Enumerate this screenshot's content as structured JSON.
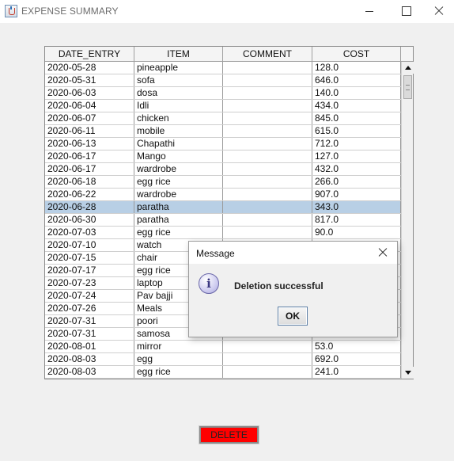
{
  "window": {
    "title": "EXPENSE SUMMARY"
  },
  "table": {
    "columns": [
      "DATE_ENTRY",
      "ITEM",
      "COMMENT",
      "COST"
    ],
    "rows": [
      [
        "2020-05-28",
        "pineapple",
        "",
        "128.0"
      ],
      [
        "2020-05-31",
        "sofa",
        "",
        "646.0"
      ],
      [
        "2020-06-03",
        "dosa",
        "",
        "140.0"
      ],
      [
        "2020-06-04",
        "Idli",
        "",
        "434.0"
      ],
      [
        "2020-06-07",
        "chicken",
        "",
        "845.0"
      ],
      [
        "2020-06-11",
        "mobile",
        "",
        "615.0"
      ],
      [
        "2020-06-13",
        "Chapathi",
        "",
        "712.0"
      ],
      [
        "2020-06-17",
        "Mango",
        "",
        "127.0"
      ],
      [
        "2020-06-17",
        "wardrobe",
        "",
        "432.0"
      ],
      [
        "2020-06-18",
        "egg rice",
        "",
        "266.0"
      ],
      [
        "2020-06-22",
        "wardrobe",
        "",
        "907.0"
      ],
      [
        "2020-06-28",
        "paratha",
        "",
        "343.0"
      ],
      [
        "2020-06-30",
        "paratha",
        "",
        "817.0"
      ],
      [
        "2020-07-03",
        "egg rice",
        "",
        "90.0"
      ],
      [
        "2020-07-10",
        "watch",
        "",
        ""
      ],
      [
        "2020-07-15",
        "chair",
        "",
        ""
      ],
      [
        "2020-07-17",
        "egg rice",
        "",
        ""
      ],
      [
        "2020-07-23",
        "laptop",
        "",
        ""
      ],
      [
        "2020-07-24",
        "Pav bajji",
        "",
        ""
      ],
      [
        "2020-07-26",
        "Meals",
        "",
        ""
      ],
      [
        "2020-07-31",
        "poori",
        "",
        ""
      ],
      [
        "2020-07-31",
        "samosa",
        "",
        ""
      ],
      [
        "2020-08-01",
        "mirror",
        "",
        "53.0"
      ],
      [
        "2020-08-03",
        "egg",
        "",
        "692.0"
      ],
      [
        "2020-08-03",
        "egg rice",
        "",
        "241.0"
      ]
    ],
    "selected_row": 11
  },
  "dialog": {
    "title": "Message",
    "message": "Deletion successful",
    "ok_label": "OK",
    "icon": "info-icon"
  },
  "actions": {
    "delete_label": "DELETE",
    "delete_color": "#ff0000"
  },
  "colors": {
    "selection": "#b8cfe5"
  }
}
